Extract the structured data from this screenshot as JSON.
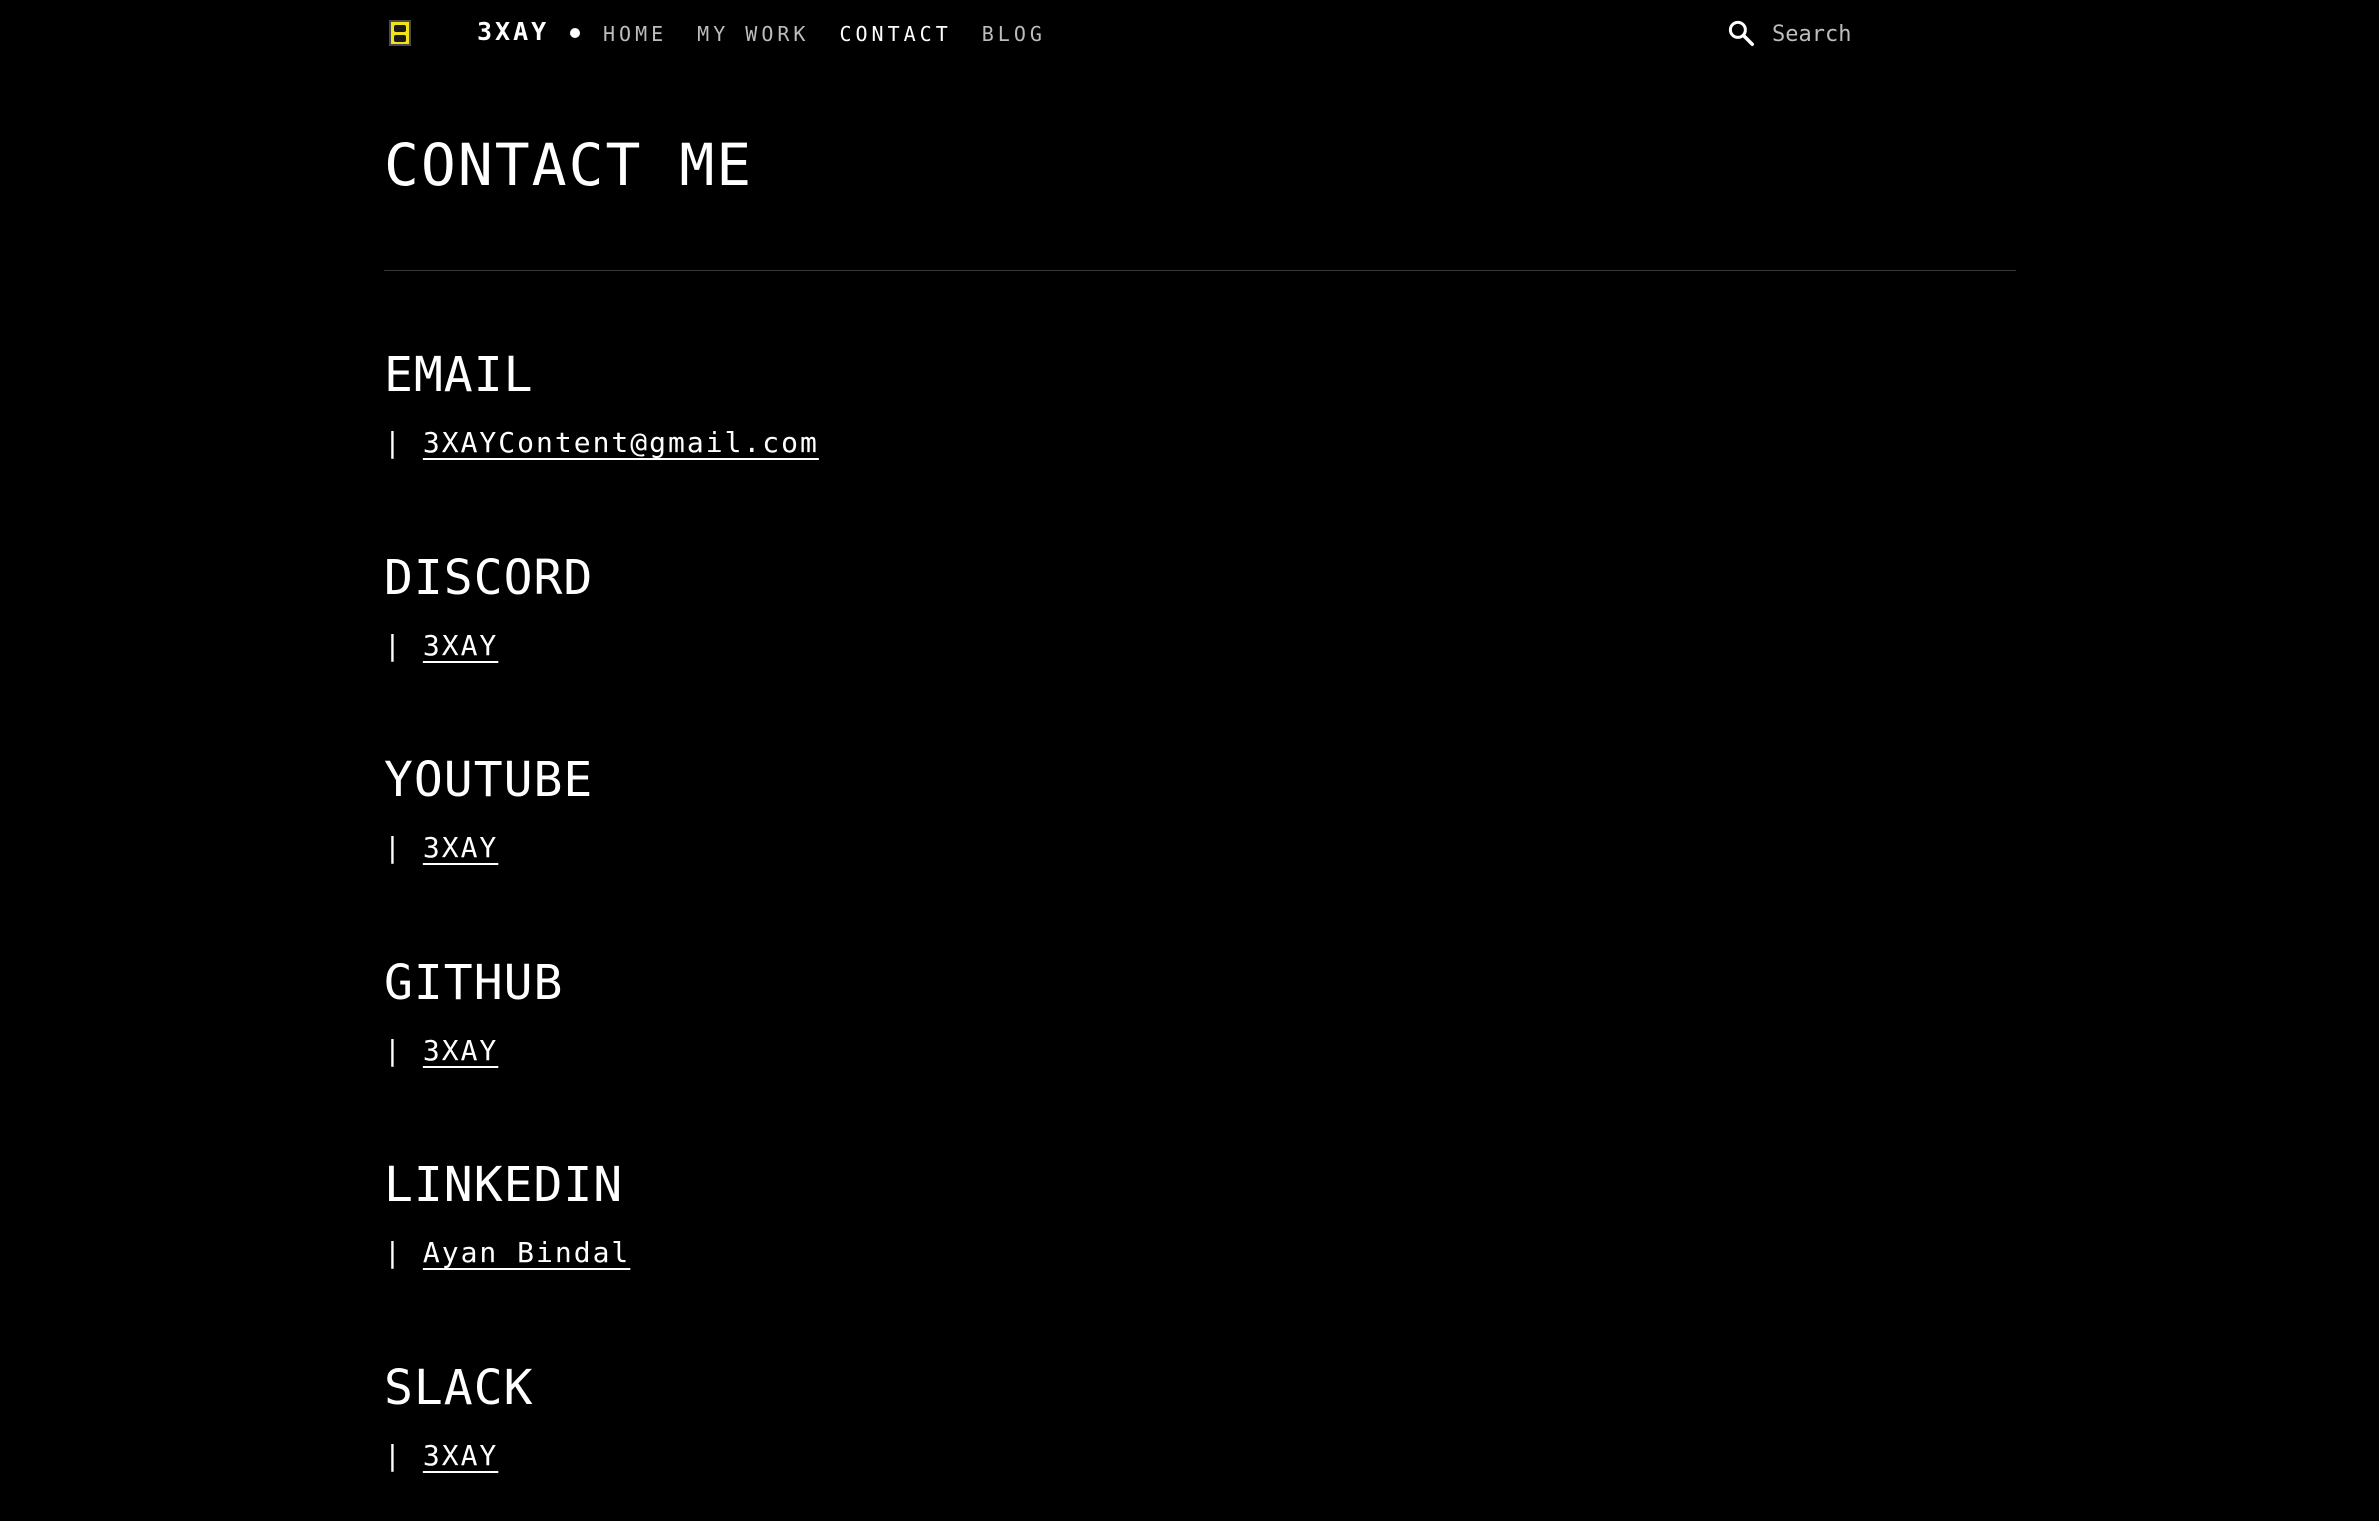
{
  "header": {
    "brand": "3XAY",
    "nav": [
      {
        "label": "HOME",
        "active": false
      },
      {
        "label": "MY WORK",
        "active": false
      },
      {
        "label": "CONTACT",
        "active": true
      },
      {
        "label": "BLOG",
        "active": false
      }
    ],
    "search": {
      "placeholder": "Search",
      "icon": "search-icon"
    },
    "logo_icon": "logo-icon"
  },
  "main": {
    "title": "CONTACT ME",
    "sections": [
      {
        "heading": "EMAIL",
        "separator": "|",
        "link": "3XAYContent@gmail.com"
      },
      {
        "heading": "DISCORD",
        "separator": "|",
        "link": "3XAY"
      },
      {
        "heading": "YOUTUBE",
        "separator": "|",
        "link": "3XAY"
      },
      {
        "heading": "GITHUB",
        "separator": "|",
        "link": "3XAY"
      },
      {
        "heading": "LINKEDIN",
        "separator": "|",
        "link": "Ayan Bindal"
      },
      {
        "heading": "SLACK",
        "separator": "|",
        "link": "3XAY"
      }
    ]
  },
  "colors": {
    "background": "#000000",
    "text": "#ffffff",
    "nav_inactive": "#bdbdbd",
    "logo_accent": "#f2e21b"
  }
}
